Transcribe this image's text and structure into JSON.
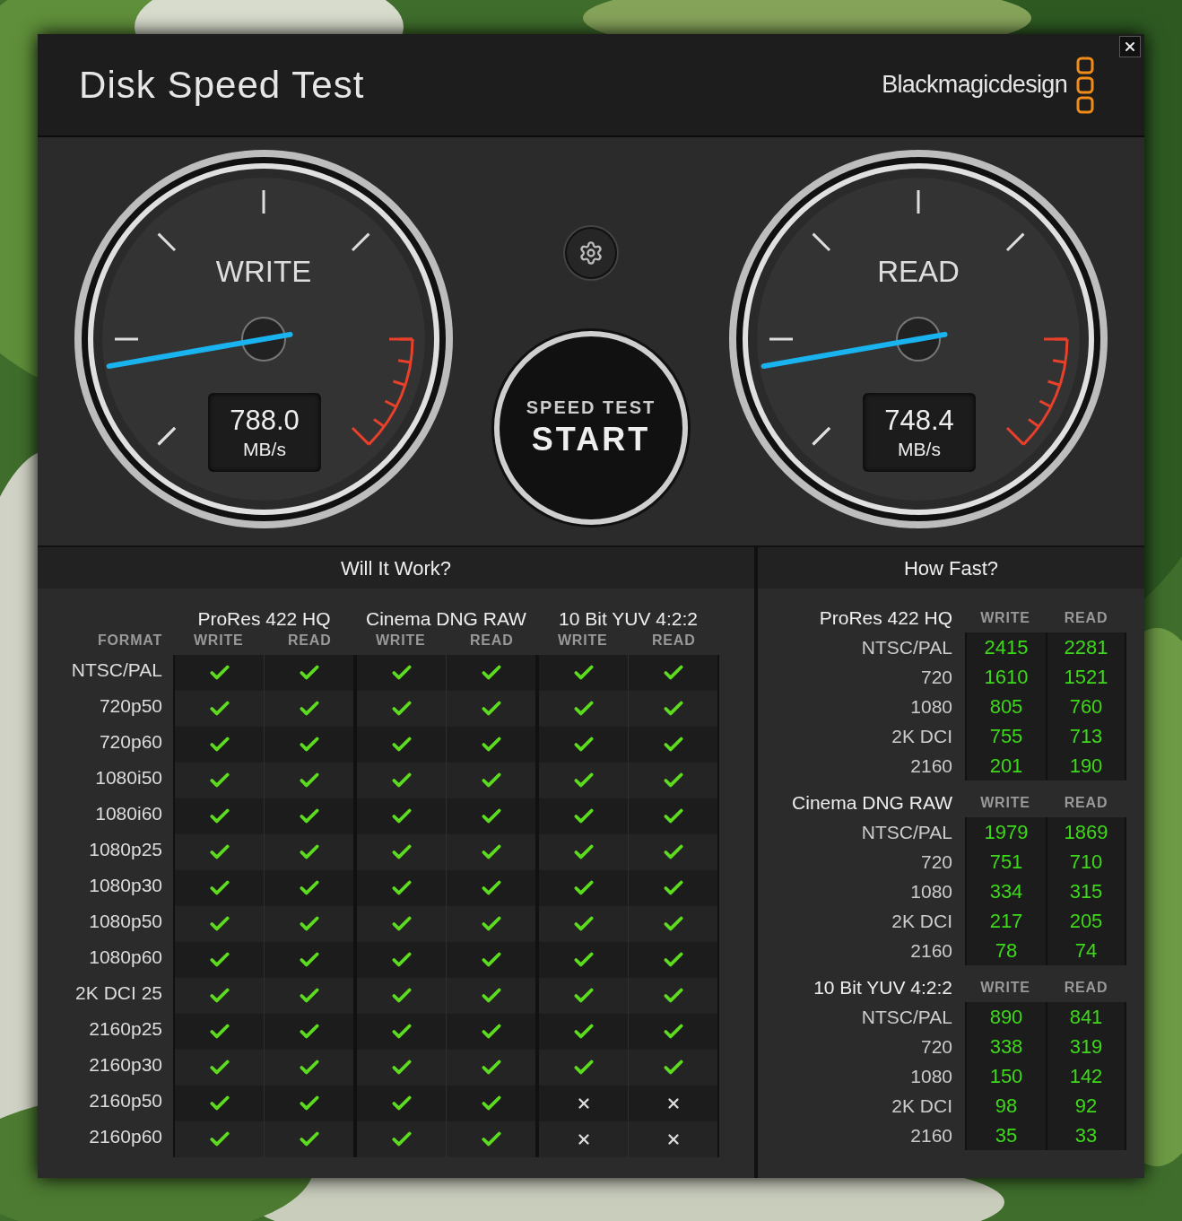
{
  "window": {
    "title": "Disk Speed Test",
    "logo_text": "Blackmagicdesign"
  },
  "gauges": [
    {
      "label": "WRITE",
      "value": "788.0",
      "unit": "MB/s",
      "level": 0.13
    },
    {
      "label": "READ",
      "value": "748.4",
      "unit": "MB/s",
      "level": 0.13
    }
  ],
  "start_button": {
    "line_1": "SPEED TEST",
    "line_2": "START"
  },
  "will_it_work": {
    "title": "Will It Work?",
    "format_header": "FORMAT",
    "groups": [
      {
        "name": "ProRes 422 HQ",
        "columns": [
          "WRITE",
          "READ"
        ]
      },
      {
        "name": "Cinema DNG RAW",
        "columns": [
          "WRITE",
          "READ"
        ]
      },
      {
        "name": "10 Bit YUV 4:2:2",
        "columns": [
          "WRITE",
          "READ"
        ]
      }
    ],
    "rows": [
      {
        "format": "NTSC/PAL",
        "results": [
          true,
          true,
          true,
          true,
          true,
          true
        ]
      },
      {
        "format": "720p50",
        "results": [
          true,
          true,
          true,
          true,
          true,
          true
        ]
      },
      {
        "format": "720p60",
        "results": [
          true,
          true,
          true,
          true,
          true,
          true
        ]
      },
      {
        "format": "1080i50",
        "results": [
          true,
          true,
          true,
          true,
          true,
          true
        ]
      },
      {
        "format": "1080i60",
        "results": [
          true,
          true,
          true,
          true,
          true,
          true
        ]
      },
      {
        "format": "1080p25",
        "results": [
          true,
          true,
          true,
          true,
          true,
          true
        ]
      },
      {
        "format": "1080p30",
        "results": [
          true,
          true,
          true,
          true,
          true,
          true
        ]
      },
      {
        "format": "1080p50",
        "results": [
          true,
          true,
          true,
          true,
          true,
          true
        ]
      },
      {
        "format": "1080p60",
        "results": [
          true,
          true,
          true,
          true,
          true,
          true
        ]
      },
      {
        "format": "2K DCI 25",
        "results": [
          true,
          true,
          true,
          true,
          true,
          true
        ]
      },
      {
        "format": "2160p25",
        "results": [
          true,
          true,
          true,
          true,
          true,
          true
        ]
      },
      {
        "format": "2160p30",
        "results": [
          true,
          true,
          true,
          true,
          true,
          true
        ]
      },
      {
        "format": "2160p50",
        "results": [
          true,
          true,
          true,
          true,
          false,
          false
        ]
      },
      {
        "format": "2160p60",
        "results": [
          true,
          true,
          true,
          true,
          false,
          false
        ]
      }
    ]
  },
  "how_fast": {
    "title": "How Fast?",
    "groups": [
      {
        "name": "ProRes 422 HQ",
        "write_header": "WRITE",
        "read_header": "READ",
        "rows": [
          {
            "label": "NTSC/PAL",
            "write": "2415",
            "read": "2281"
          },
          {
            "label": "720",
            "write": "1610",
            "read": "1521"
          },
          {
            "label": "1080",
            "write": "805",
            "read": "760"
          },
          {
            "label": "2K DCI",
            "write": "755",
            "read": "713"
          },
          {
            "label": "2160",
            "write": "201",
            "read": "190"
          }
        ]
      },
      {
        "name": "Cinema DNG RAW",
        "write_header": "WRITE",
        "read_header": "READ",
        "rows": [
          {
            "label": "NTSC/PAL",
            "write": "1979",
            "read": "1869"
          },
          {
            "label": "720",
            "write": "751",
            "read": "710"
          },
          {
            "label": "1080",
            "write": "334",
            "read": "315"
          },
          {
            "label": "2K DCI",
            "write": "217",
            "read": "205"
          },
          {
            "label": "2160",
            "write": "78",
            "read": "74"
          }
        ]
      },
      {
        "name": "10 Bit YUV 4:2:2",
        "write_header": "WRITE",
        "read_header": "READ",
        "rows": [
          {
            "label": "NTSC/PAL",
            "write": "890",
            "read": "841"
          },
          {
            "label": "720",
            "write": "338",
            "read": "319"
          },
          {
            "label": "1080",
            "write": "150",
            "read": "142"
          },
          {
            "label": "2K DCI",
            "write": "98",
            "read": "92"
          },
          {
            "label": "2160",
            "write": "35",
            "read": "33"
          }
        ]
      }
    ]
  }
}
